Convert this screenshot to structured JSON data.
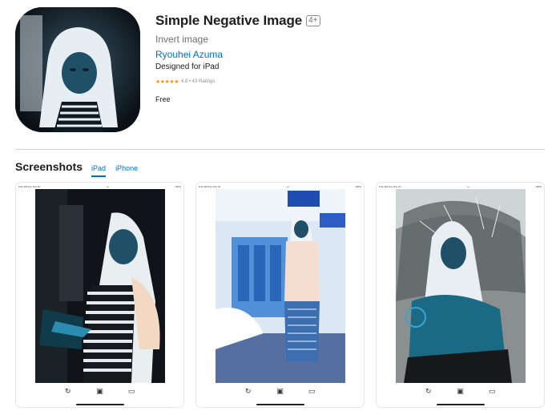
{
  "app": {
    "title": "Simple Negative Image",
    "age_rating": "4+",
    "subtitle": "Invert image",
    "developer": "Ryouhei Azuma",
    "designed_for": "Designed for iPad",
    "stars": "★★★★★",
    "rating_text": "4.8 • 43 Ratings",
    "price": "Free"
  },
  "screenshots": {
    "title": "Screenshots",
    "tabs": [
      {
        "label": "iPad",
        "active": true
      },
      {
        "label": "iPhone",
        "active": false
      }
    ],
    "status_left": "9:41 AM   Tue Nov 16",
    "status_center": "•••",
    "status_right": "100%",
    "toolbar_icons": [
      "rotate-icon",
      "save-icon",
      "folder-icon"
    ]
  },
  "colors": {
    "accent": "#0070c9",
    "star": "#ff9500",
    "text": "#1d1d1f",
    "secondary": "#6e6e73"
  }
}
